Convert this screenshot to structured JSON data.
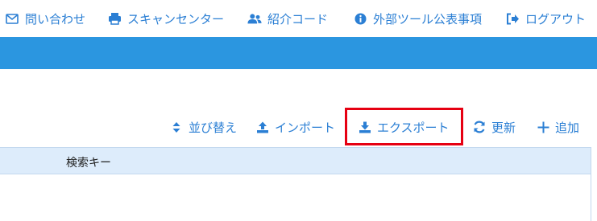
{
  "top_nav": {
    "contact": "問い合わせ",
    "scan_center": "スキャンセンター",
    "referral_code": "紹介コード",
    "external_tools": "外部ツール公表事項",
    "logout": "ログアウト"
  },
  "toolbar": {
    "sort": "並び替え",
    "import": "インポート",
    "export": "エクスポート",
    "refresh": "更新",
    "add": "追加"
  },
  "table": {
    "columns": [
      "検索キー"
    ]
  },
  "colors": {
    "link": "#2b7fd4",
    "banner": "#2b96e0",
    "header_bg": "#ddecfb",
    "highlight": "#e60012"
  }
}
